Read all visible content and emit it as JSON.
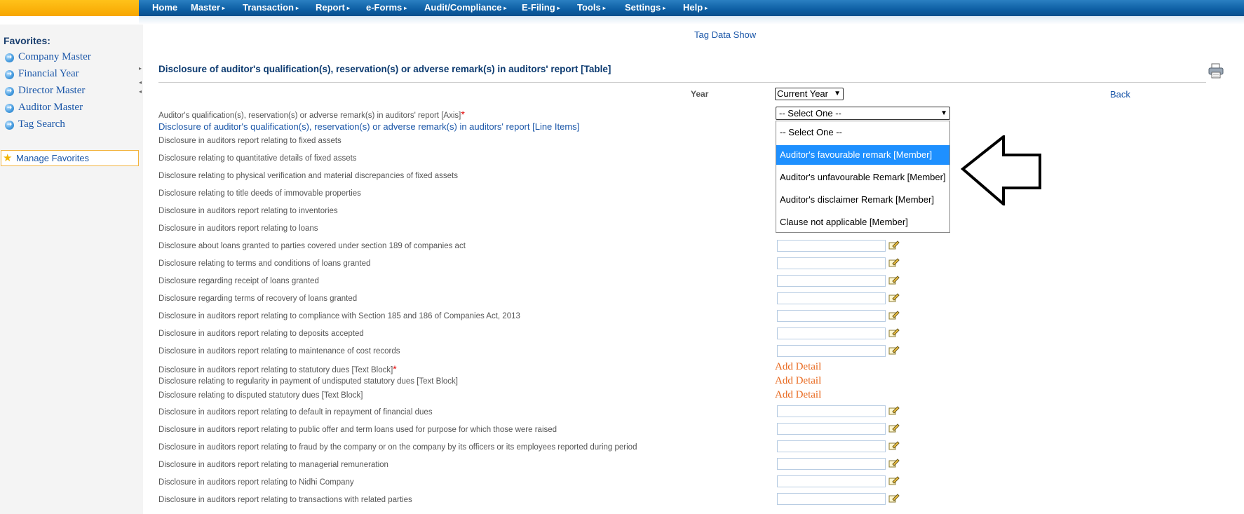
{
  "menu": [
    {
      "label": "Home",
      "has_arrow": false
    },
    {
      "label": "Master",
      "has_arrow": true
    },
    {
      "label": "Transaction",
      "has_arrow": true
    },
    {
      "label": "Report",
      "has_arrow": true
    },
    {
      "label": "e-Forms",
      "has_arrow": true
    },
    {
      "label": "Audit/Compliance",
      "has_arrow": true
    },
    {
      "label": "E-Filing",
      "has_arrow": true
    },
    {
      "label": "Tools",
      "has_arrow": true
    },
    {
      "label": "Settings",
      "has_arrow": true
    },
    {
      "label": "Help",
      "has_arrow": true
    }
  ],
  "menu_arrow": "▸",
  "sidebar": {
    "title": "Favorites:",
    "items": [
      {
        "label": "Company Master"
      },
      {
        "label": "Financial Year"
      },
      {
        "label": "Director Master"
      },
      {
        "label": "Auditor Master"
      },
      {
        "label": "Tag Search"
      }
    ],
    "manage_label": "Manage Favorites"
  },
  "main": {
    "tag_link": "Tag Data Show",
    "heading": "Disclosure of auditor's qualification(s), reservation(s) or adverse remark(s) in auditors' report [Table]",
    "year_label": "Year",
    "year_value": "Current Year",
    "back_label": "Back",
    "axis_label": "Auditor's qualification(s), reservation(s) or adverse remark(s) in auditors' report [Axis]",
    "required_mark": "*",
    "axis_value": "-- Select One --",
    "line_items_label": "Disclosure of auditor's qualification(s), reservation(s) or adverse remark(s) in auditors' report [Line Items]",
    "dropdown_options": [
      {
        "label": "-- Select One --",
        "selected": false
      },
      {
        "label": "Auditor's favourable remark [Member]",
        "selected": true
      },
      {
        "label": "Auditor's unfavourable Remark [Member]",
        "selected": false
      },
      {
        "label": "Auditor's disclaimer Remark [Member]",
        "selected": false
      },
      {
        "label": "Clause not applicable [Member]",
        "selected": false
      }
    ],
    "add_detail_label": "Add Detail",
    "rows": [
      {
        "label": "Disclosure in auditors report relating to fixed assets",
        "control": "hidden",
        "required": false
      },
      {
        "label": "Disclosure relating to quantitative details of fixed assets",
        "control": "hidden",
        "required": false
      },
      {
        "label": "Disclosure relating to physical verification and material discrepancies of fixed assets",
        "control": "hidden",
        "required": false
      },
      {
        "label": "Disclosure relating to title deeds of immovable properties",
        "control": "hidden",
        "required": false
      },
      {
        "label": "Disclosure in auditors report relating to inventories",
        "control": "hidden",
        "required": false
      },
      {
        "label": "Disclosure in auditors report relating to loans",
        "control": "hidden",
        "required": false
      },
      {
        "label": "Disclosure about loans granted to parties covered under section 189 of companies act",
        "control": "input",
        "required": false
      },
      {
        "label": "Disclosure relating to terms and conditions of loans granted",
        "control": "input",
        "required": false
      },
      {
        "label": "Disclosure regarding receipt of loans granted",
        "control": "input",
        "required": false
      },
      {
        "label": "Disclosure regarding terms of recovery of loans granted",
        "control": "input",
        "required": false
      },
      {
        "label": "Disclosure in auditors report relating to compliance with Section 185 and 186 of Companies Act, 2013",
        "control": "input",
        "required": false
      },
      {
        "label": "Disclosure in auditors report relating to deposits accepted",
        "control": "input",
        "required": false
      },
      {
        "label": "Disclosure in auditors report relating to maintenance of cost records",
        "control": "input",
        "required": false
      },
      {
        "label": "Disclosure in auditors report relating to statutory dues [Text Block]",
        "control": "add",
        "required": true
      },
      {
        "label": "Disclosure relating to regularity in payment of undisputed statutory dues [Text Block]",
        "control": "add",
        "required": false
      },
      {
        "label": "Disclosure relating to disputed statutory dues [Text Block]",
        "control": "add",
        "required": false
      },
      {
        "label": "Disclosure in auditors report relating to default in repayment of financial dues",
        "control": "input",
        "required": false
      },
      {
        "label": "Disclosure in auditors report relating to public offer and term loans used for purpose for which those were raised",
        "control": "input",
        "required": false
      },
      {
        "label": "Disclosure in auditors report relating to fraud by the company or on the company by its officers or its employees reported during period",
        "control": "input",
        "required": false
      },
      {
        "label": "Disclosure in auditors report relating to managerial remuneration",
        "control": "input",
        "required": false
      },
      {
        "label": "Disclosure in auditors report relating to Nidhi Company",
        "control": "input",
        "required": false
      },
      {
        "label": "Disclosure in auditors report relating to transactions with related parties",
        "control": "input",
        "required": false
      }
    ]
  },
  "colors": {
    "menu_bg": "#0d5ea3",
    "link": "#1a56a8",
    "heading": "#0d3b70",
    "add_detail": "#e8671c",
    "selected_option": "#1e90ff",
    "required": "#e00000"
  },
  "icons": {
    "bullet": "arrow-circle-icon",
    "star": "star-icon",
    "print": "printer-icon",
    "edit": "edit-pencil-icon",
    "pointer": "left-arrow-outline-icon"
  }
}
